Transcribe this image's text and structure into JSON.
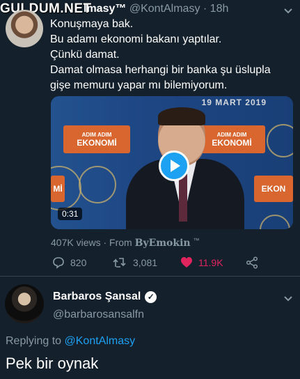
{
  "watermark": "GULDUM.NET",
  "tweet": {
    "name_visible": "lmasy™",
    "handle": "@KontAlmasy",
    "separator": "·",
    "time": "18h",
    "lines": [
      "Konuşmaya bak.",
      "Bu adamı ekonomi bakanı yaptılar.",
      "Çünkü damat.",
      "Damat olmasa herhangi bir banka şu üslupla",
      "gişe memuru yapar mı bilemiyorum."
    ],
    "media": {
      "date_overlay": "19 MART 2019",
      "banner_top": "ADIM ADIM",
      "banner_main": "EKONOMİ",
      "banner_partial": "EKON",
      "banner_partial_left": "Mİ",
      "duration": "0:31"
    },
    "views": "407K views",
    "from_label": "From",
    "source": "ByEmokin",
    "source_tm": "™",
    "replies": "820",
    "retweets": "3,081",
    "likes": "11.9K",
    "colors": {
      "like": "#e0245e",
      "link": "#1da1f2",
      "bg": "#14202c",
      "muted": "#8899a6"
    }
  },
  "reply": {
    "name": "Barbaros Şansal",
    "handle": "@barbarosansalfn",
    "replying_prefix": "Replying to",
    "replying_to": "@KontAlmasy",
    "text": "Pek bir oynak"
  },
  "icons": [
    "chevron-down-icon",
    "play-icon",
    "reply-icon",
    "retweet-icon",
    "heart-icon",
    "share-icon",
    "verified-badge-icon"
  ]
}
